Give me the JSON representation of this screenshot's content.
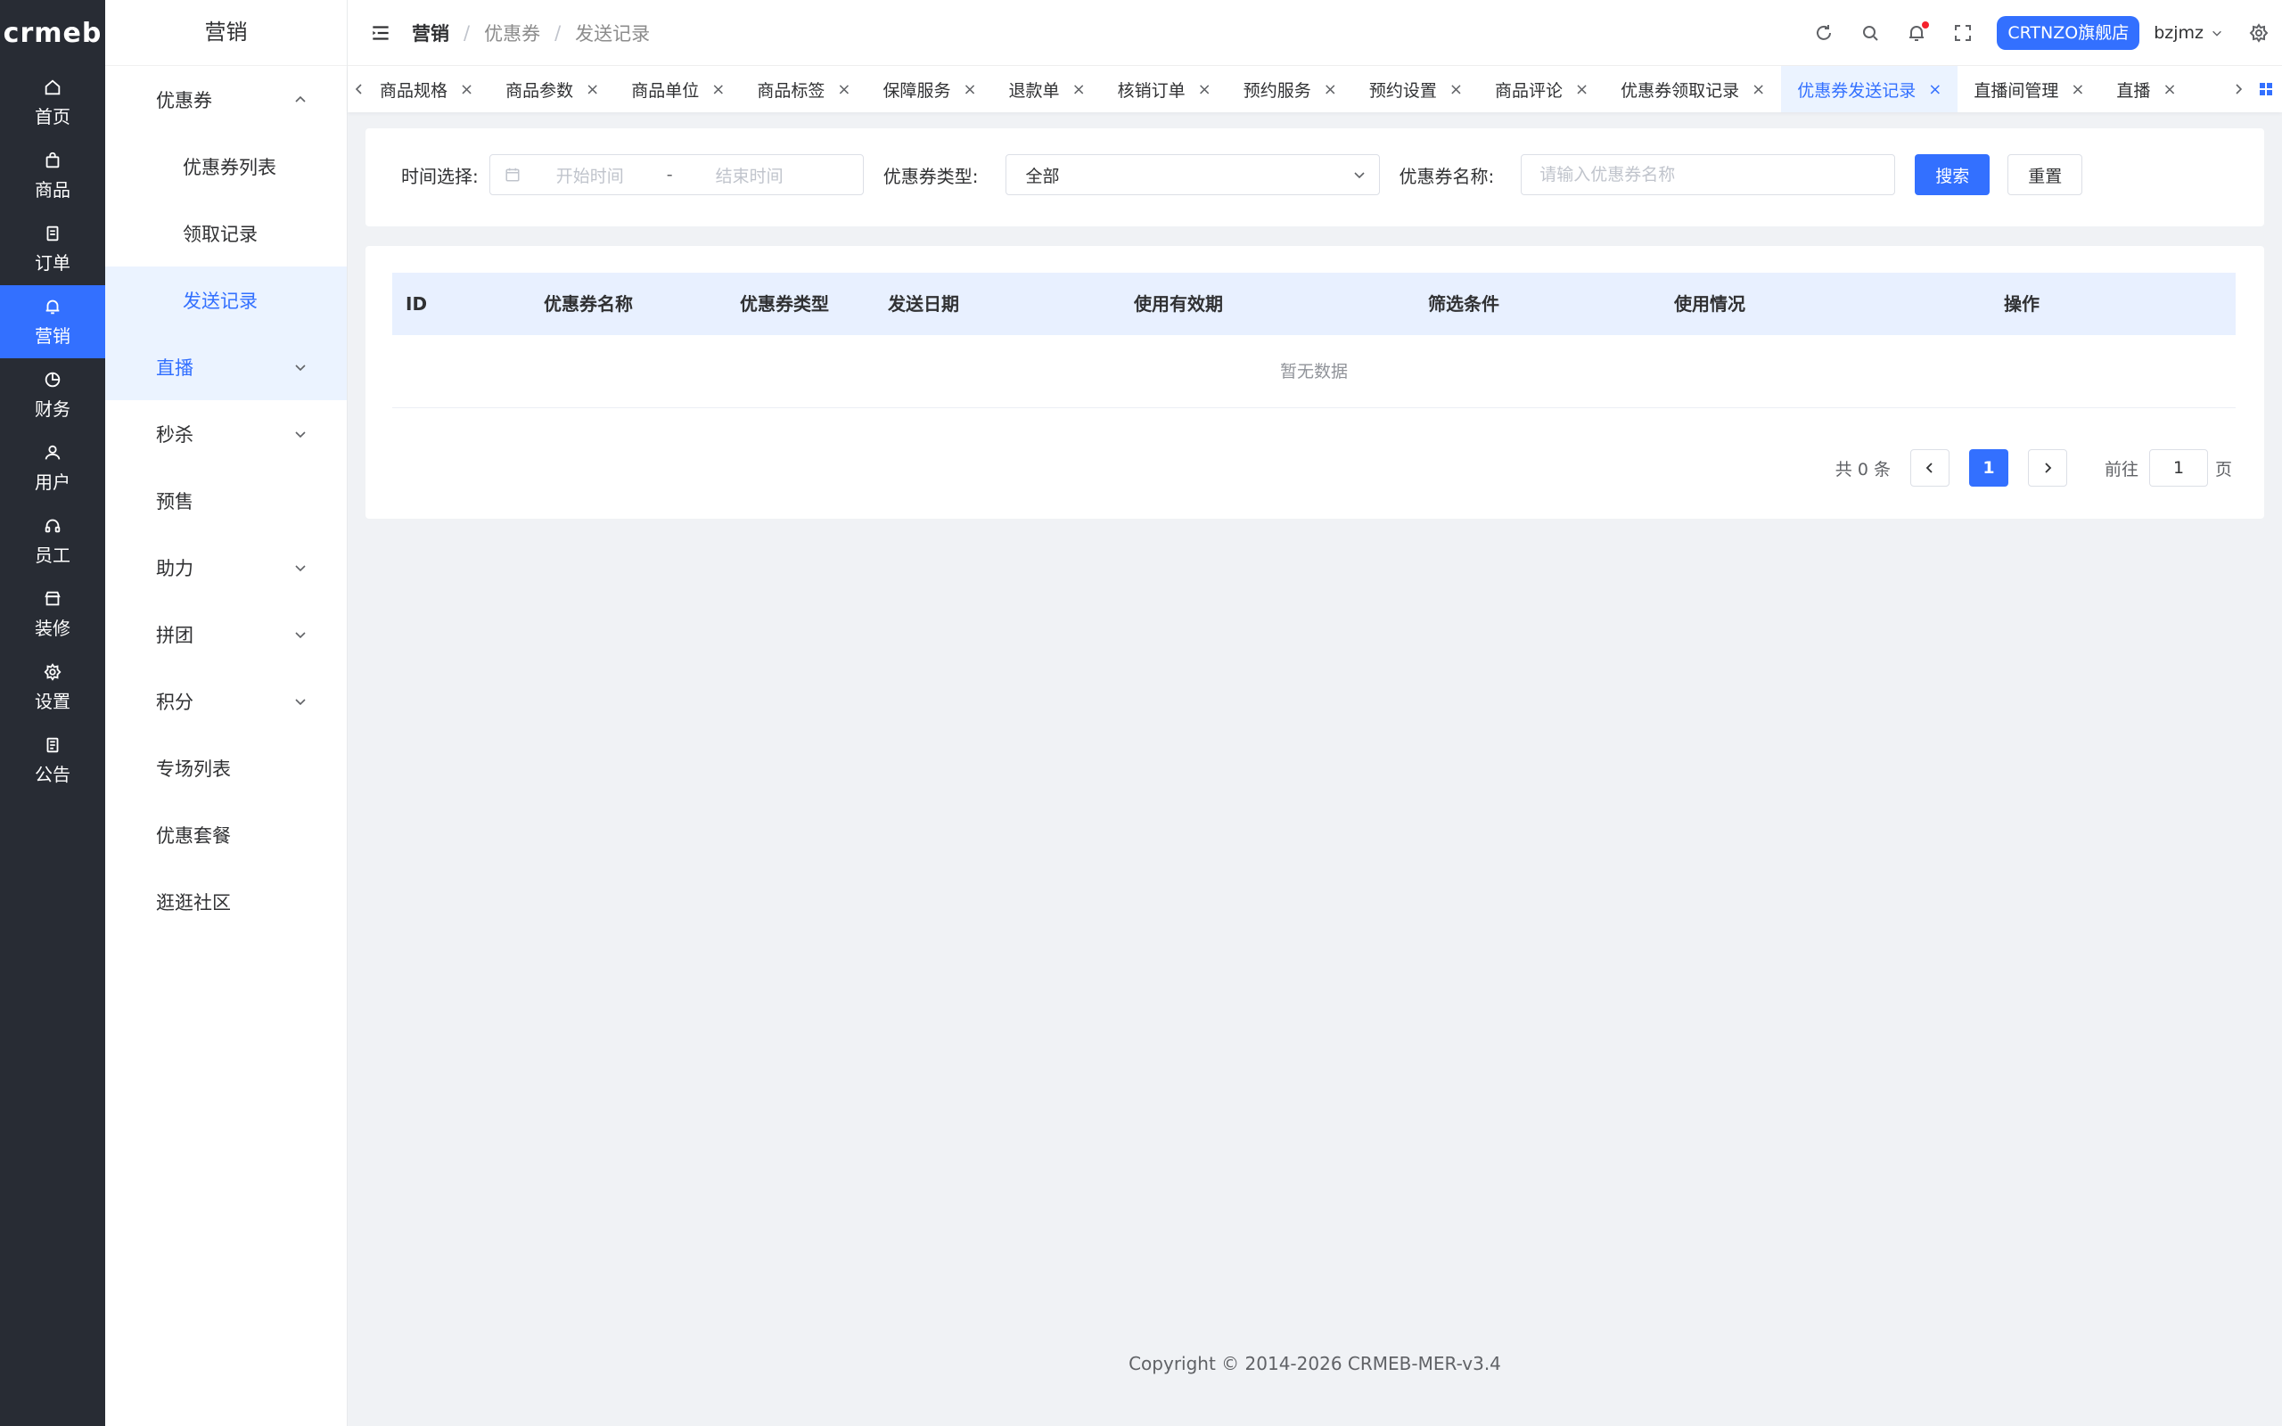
{
  "brand": {
    "logo_text": "crmeb"
  },
  "rail": {
    "items": [
      {
        "label": "首页",
        "icon": "home-icon"
      },
      {
        "label": "商品",
        "icon": "bag-icon"
      },
      {
        "label": "订单",
        "icon": "document-icon"
      },
      {
        "label": "营销",
        "icon": "bell-icon",
        "active": true
      },
      {
        "label": "财务",
        "icon": "pie-icon"
      },
      {
        "label": "用户",
        "icon": "user-icon"
      },
      {
        "label": "员工",
        "icon": "headset-icon"
      },
      {
        "label": "装修",
        "icon": "store-icon"
      },
      {
        "label": "设置",
        "icon": "gear-icon"
      },
      {
        "label": "公告",
        "icon": "notice-icon"
      }
    ]
  },
  "submenu": {
    "title": "营销",
    "items": [
      {
        "label": "优惠券",
        "chevron": "up"
      },
      {
        "label": "优惠券列表",
        "child": true
      },
      {
        "label": "领取记录",
        "child": true
      },
      {
        "label": "发送记录",
        "child": true,
        "selected": true
      },
      {
        "label": "直播",
        "chevron": "down"
      },
      {
        "label": "秒杀",
        "chevron": "down"
      },
      {
        "label": "预售"
      },
      {
        "label": "助力",
        "chevron": "down"
      },
      {
        "label": "拼团",
        "chevron": "down"
      },
      {
        "label": "积分",
        "chevron": "down"
      },
      {
        "label": "专场列表"
      },
      {
        "label": "优惠套餐"
      },
      {
        "label": "逛逛社区"
      }
    ]
  },
  "header": {
    "breadcrumb": [
      "营销",
      "优惠券",
      "发送记录"
    ],
    "separator": "/",
    "store_label": "CRTNZO旗舰店",
    "username": "bzjmz"
  },
  "tabs": {
    "items": [
      "商品规格",
      "商品参数",
      "商品单位",
      "商品标签",
      "保障服务",
      "退款单",
      "核销订单",
      "预约服务",
      "预约设置",
      "商品评论",
      "优惠券领取记录",
      "优惠券发送记录",
      "直播间管理",
      "直播"
    ],
    "active_index": 11,
    "close_glyph": "×"
  },
  "filters": {
    "time_label": "时间选择:",
    "start_placeholder": "开始时间",
    "range_separator": "-",
    "end_placeholder": "结束时间",
    "type_label": "优惠券类型:",
    "type_value": "全部",
    "name_label": "优惠券名称:",
    "name_placeholder": "请输入优惠券名称",
    "search_button": "搜索",
    "reset_button": "重置"
  },
  "table": {
    "columns": [
      "ID",
      "优惠券名称",
      "优惠券类型",
      "发送日期",
      "使用有效期",
      "筛选条件",
      "使用情况",
      "操作"
    ],
    "empty_text": "暂无数据"
  },
  "pagination": {
    "total_text": "共 0 条",
    "current_page": "1",
    "goto_label": "前往",
    "goto_value": "1",
    "page_suffix": "页"
  },
  "footer": {
    "copyright": "Copyright © 2014-2026 CRMEB-MER-v3.4"
  },
  "colors": {
    "primary": "#3370ff",
    "rail_bg": "#282c34",
    "page_bg": "#f0f2f5",
    "header_row_bg": "#e8f0ff"
  }
}
